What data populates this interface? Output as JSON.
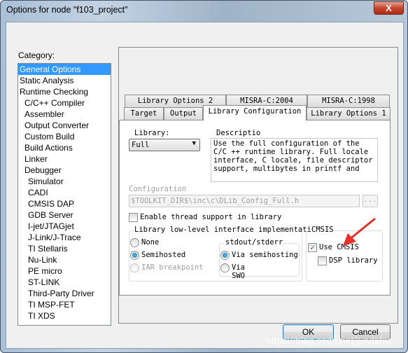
{
  "window": {
    "title": "Options for node \"f103_project\"",
    "close_icon": "X"
  },
  "category": {
    "label": "Category:",
    "items": [
      {
        "label": "General Options",
        "level": 0,
        "selected": true
      },
      {
        "label": "Static Analysis",
        "level": 0
      },
      {
        "label": "Runtime Checking",
        "level": 0
      },
      {
        "label": "C/C++ Compiler",
        "level": 1
      },
      {
        "label": "Assembler",
        "level": 1
      },
      {
        "label": "Output Converter",
        "level": 1
      },
      {
        "label": "Custom Build",
        "level": 1
      },
      {
        "label": "Build Actions",
        "level": 1
      },
      {
        "label": "Linker",
        "level": 1
      },
      {
        "label": "Debugger",
        "level": 1
      },
      {
        "label": "Simulator",
        "level": 2
      },
      {
        "label": "CADI",
        "level": 2
      },
      {
        "label": "CMSIS DAP",
        "level": 2
      },
      {
        "label": "GDB Server",
        "level": 2
      },
      {
        "label": "I-jet/JTAGjet",
        "level": 2
      },
      {
        "label": "J-Link/J-Trace",
        "level": 2
      },
      {
        "label": "TI Stellaris",
        "level": 2
      },
      {
        "label": "Nu-Link",
        "level": 2
      },
      {
        "label": "PE micro",
        "level": 2
      },
      {
        "label": "ST-LINK",
        "level": 2
      },
      {
        "label": "Third-Party Driver",
        "level": 2
      },
      {
        "label": "TI MSP-FET",
        "level": 2
      },
      {
        "label": "TI XDS",
        "level": 2
      }
    ]
  },
  "tabs": {
    "row1": [
      "Library Options 2",
      "MISRA-C:2004",
      "MISRA-C:1998"
    ],
    "row2": [
      "Target",
      "Output",
      "Library Configuration",
      "Library Options 1"
    ],
    "active": "Library Configuration"
  },
  "library": {
    "label": "Library:",
    "value": "Full"
  },
  "description": {
    "label": "Descriptio",
    "text": "Use the full configuration of the C/C ++ runtime library. Full locale interface, C locale, file descriptor support, multibytes in printf and"
  },
  "configuration": {
    "label": "Configuration",
    "value": "$TOOLKIT_DIR$\\inc\\c\\DLib_Config_Full.h",
    "browse": "..."
  },
  "thread_support": {
    "label": "Enable thread support in library",
    "checked": false
  },
  "low_level": {
    "label": "Library low-level interface implementation",
    "options": [
      {
        "label": "None",
        "selected": false
      },
      {
        "label": "Semihosted",
        "selected": true
      },
      {
        "label": "IAR breakpoint",
        "selected": false,
        "disabled": true
      }
    ]
  },
  "stdout": {
    "label": "stdout/stderr",
    "options": [
      {
        "label": "Via semihosting",
        "selected": true
      },
      {
        "label": "Via SWO",
        "selected": false
      }
    ]
  },
  "cmsis": {
    "label": "CMSIS",
    "use_cmsis": {
      "label": "Use CMSIS",
      "checked": true
    },
    "dsp": {
      "label": "DSP library",
      "checked": false
    }
  },
  "annotation_color": "#e8302a",
  "buttons": {
    "ok": "OK",
    "cancel": "Cancel"
  },
  "watermark": "https://blog.csdn.net/jxndsfss"
}
